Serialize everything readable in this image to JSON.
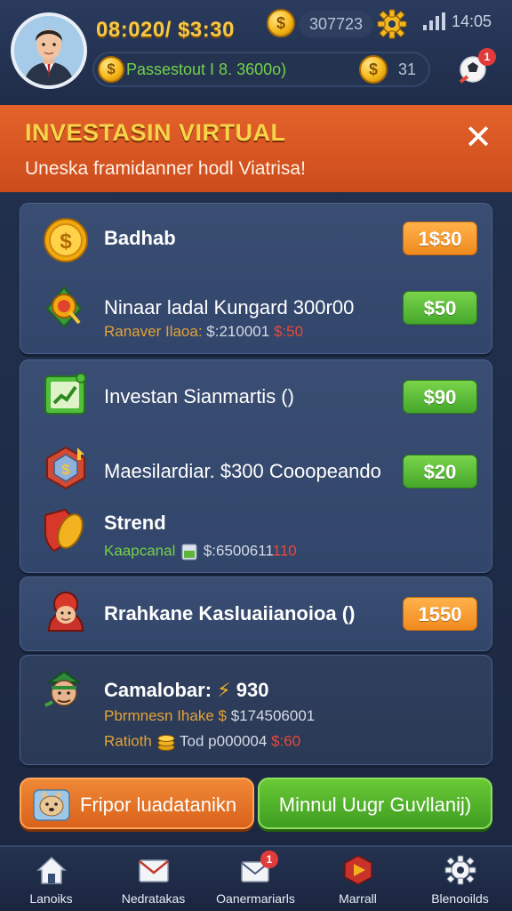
{
  "header": {
    "balance": "08:020/ $3:30",
    "coins_pill": "307723",
    "time": "14:05",
    "pass_label": "Passestout I 8. 3600o)",
    "pass_value": "31",
    "alert_count": "1"
  },
  "banner": {
    "title": "INVESTASIN VIRTUAL",
    "subtitle": "Uneska framidanner hodl Viatrisa!"
  },
  "cards": [
    {
      "rows": [
        {
          "title": "Badhab",
          "price": "1$30",
          "icon": "gold-coin-icon"
        },
        {
          "title": "Ninaar ladal Kungard 300r00",
          "sub": "Ranaver Ilaoa: ",
          "sub_white": "$:210001",
          "sub_red": "$:50",
          "price": "$50",
          "icon": "target-shield-icon"
        }
      ]
    },
    {
      "rows": [
        {
          "title": "Investan Sianmartis ()",
          "price": "$90",
          "icon": "growth-chart-icon"
        },
        {
          "title": "Maesilardiar. $300 Cooopeando",
          "price": "$20",
          "icon": "gem-badge-icon"
        },
        {
          "title": "Strend",
          "sub": "Kaapcanal",
          "sub_white": "$:6500611",
          "sub_red": "110",
          "icon": "shield-coin-icon"
        }
      ]
    },
    {
      "rows": [
        {
          "title": "Rrahkane Kasluaiianoioa ()",
          "price": "1550",
          "icon": "hooded-character-icon"
        }
      ]
    },
    {
      "rows": [
        {
          "title": "Camalobar:",
          "title_value": "930",
          "sub1": "Pbrmnesn Ihake $ ",
          "sub1_white": "$174506001",
          "sub2": "Ratioth",
          "sub2_white": "Tod p000004",
          "sub2_red": "$:60",
          "icon": "goblin-character-icon"
        }
      ]
    }
  ],
  "actions": {
    "left_label": "Fripor luadatanikn",
    "right_label": "Minnul Uugr Guvllanij)"
  },
  "nav": [
    {
      "label": "Lanoiks",
      "icon": "home-icon"
    },
    {
      "label": "Nedratakas",
      "icon": "mail-icon"
    },
    {
      "label": "Oanermariarls",
      "icon": "mail-alert-icon",
      "badge": "1"
    },
    {
      "label": "Marrall",
      "icon": "play-badge-icon"
    },
    {
      "label": "Blenooilds",
      "icon": "gear-icon"
    }
  ],
  "colors": {
    "banner": "#e15c26",
    "accent_gold": "#f7c844",
    "price_orange": "#f39a2a",
    "price_green": "#55b533",
    "card_bg": "#36496e"
  }
}
